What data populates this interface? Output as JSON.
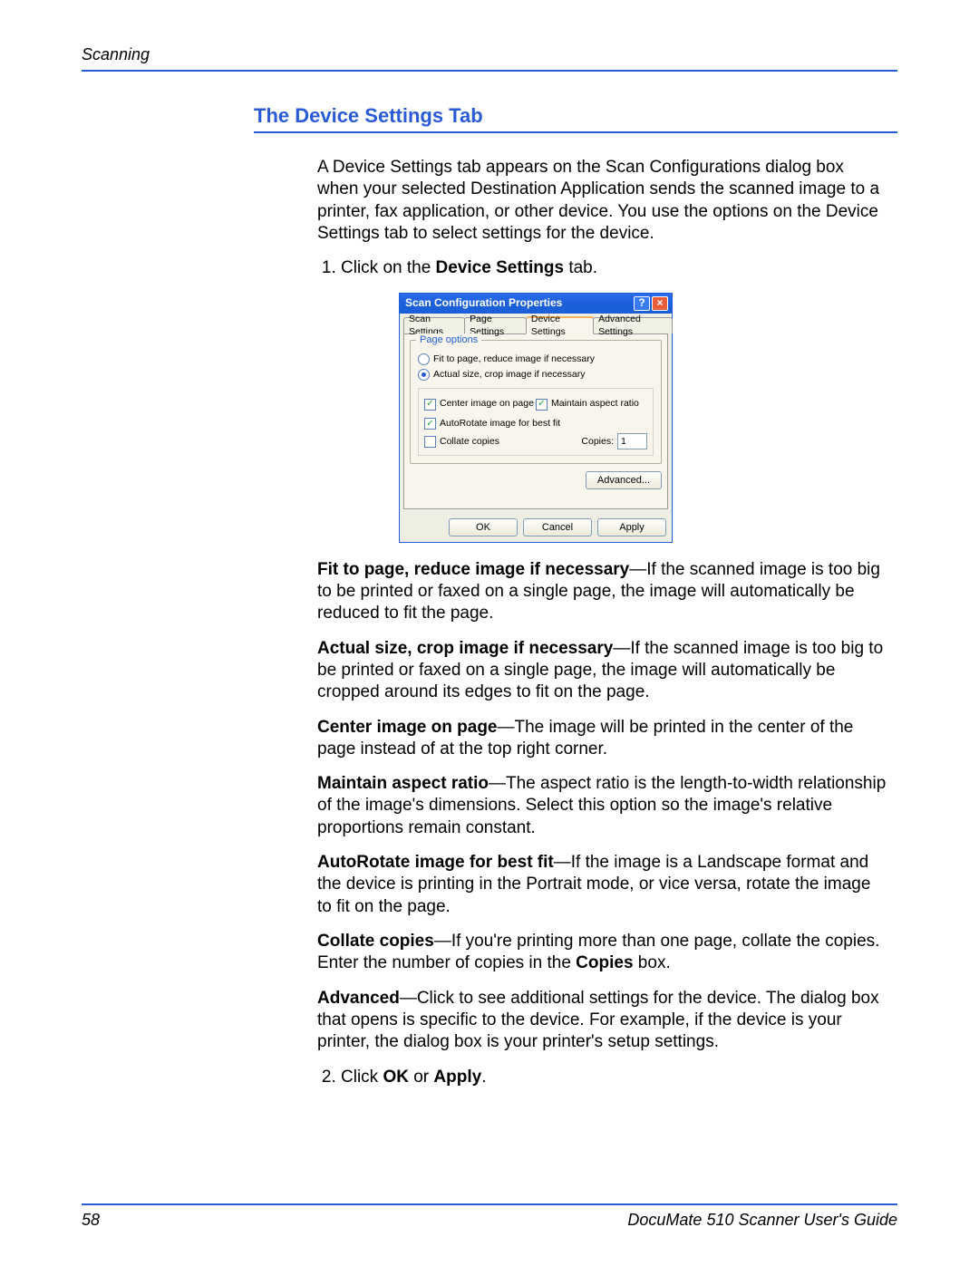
{
  "header": {
    "running_head": "Scanning"
  },
  "section": {
    "title": "The Device Settings Tab"
  },
  "intro": "A Device Settings tab appears on the Scan Configurations dialog box when your selected Destination Application sends the scanned image to a printer, fax application, or other device. You use the options on the Device Settings tab to select settings for the device.",
  "step1_prefix": "Click on the ",
  "step1_bold": "Device Settings",
  "step1_suffix": " tab.",
  "dialog": {
    "title": "Scan Configuration Properties",
    "tabs": {
      "t0": "Scan Settings",
      "t1": "Page Settings",
      "t2": "Device Settings",
      "t3": "Advanced Settings"
    },
    "groupbox": "Page options",
    "opt_fit": "Fit to page, reduce image if necessary",
    "opt_actual": "Actual size, crop image if necessary",
    "opt_center": "Center image on page",
    "opt_aspect": "Maintain aspect ratio",
    "opt_autorotate": "AutoRotate image for best fit",
    "opt_collate": "Collate copies",
    "copies_label": "Copies:",
    "copies_value": "1",
    "advanced_btn": "Advanced...",
    "ok": "OK",
    "cancel": "Cancel",
    "apply": "Apply"
  },
  "desc": {
    "fit_b": "Fit to page, reduce image if necessary",
    "fit_t": "—If the scanned image is too big to be printed or faxed on a single page, the image will automatically be reduced to fit the page.",
    "actual_b": "Actual size, crop image if necessary",
    "actual_t": "—If the scanned image is too big to be printed or faxed on a single page, the image will automatically be cropped around its edges to fit on the page.",
    "center_b": "Center image on page",
    "center_t": "—The image will be printed in the center of the page instead of at the top right corner.",
    "aspect_b": "Maintain aspect ratio",
    "aspect_t": "—The aspect ratio is the length-to-width relationship of the image's dimensions. Select this option so the image's relative proportions remain constant.",
    "auto_b": "AutoRotate image for best fit",
    "auto_t": "—If the image is a Landscape format and the device is printing in the Portrait mode, or vice versa, rotate the image to fit on the page.",
    "collate_b": "Collate copies",
    "collate_t": "—If you're printing more than one page, collate the copies. Enter the number of copies in the ",
    "collate_box": "Copies",
    "collate_end": " box.",
    "adv_b": "Advanced",
    "adv_t": "—Click to see additional settings for the device. The dialog box that opens is specific to the device. For example, if the device is your printer, the dialog box is your printer's setup settings."
  },
  "step2_prefix": "Click ",
  "step2_ok": "OK",
  "step2_mid": " or ",
  "step2_apply": "Apply",
  "step2_end": ".",
  "footer": {
    "page": "58",
    "book": "DocuMate 510 Scanner User's Guide"
  }
}
